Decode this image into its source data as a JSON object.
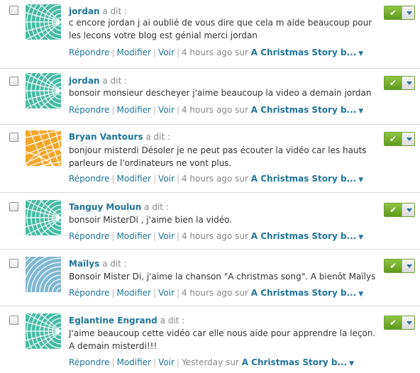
{
  "colors": {
    "link": "#21759b",
    "approve_green": "#7ab13b",
    "avatar_teal": "#45bba3",
    "avatar_orange": "#f4a62a",
    "avatar_blue": "#7eb7d3"
  },
  "labels": {
    "said": "a dit :",
    "reply": "Répondre",
    "edit": "Modifier",
    "view": "Voir",
    "on": "sur",
    "sep": "|"
  },
  "comments": [
    {
      "author": "jordan",
      "avatar_style": "teal-pattern",
      "text": "c encore jordan j ai oublié de vous dire que cela m aide beaucoup pour les lecons votre blog est génial merci jordan",
      "time": "4 hours ago",
      "post": "A Christmas Story b..."
    },
    {
      "author": "jordan",
      "avatar_style": "teal-pattern",
      "text": "bonsoir monsieur descheyer j'aime beaucoup la video a demain jordan",
      "time": "4 hours ago",
      "post": "A Christmas Story b..."
    },
    {
      "author": "Bryan Vantours",
      "avatar_style": "orange-pattern",
      "text": "bonjour misterdi Désoler je ne peut pas écouter la vidéo car les hauts parleurs de l'ordinateurs ne vont plus.",
      "time": "4 hours ago",
      "post": "A Christmas Story b..."
    },
    {
      "author": "Tanguy Moulun",
      "avatar_style": "teal-pattern",
      "text": "bonsoir MisterDi , j'aime bien la vidéo.",
      "time": "4 hours ago",
      "post": "A Christmas Story b..."
    },
    {
      "author": "Maïlys",
      "avatar_style": "blue-pattern",
      "text": "Bonsoir Mister Di, j'aime la chanson \"A christmas song\". A bienôt Maïlys",
      "time": "4 hours ago",
      "post": "A Christmas Story b..."
    },
    {
      "author": "Eglantine Engrand",
      "avatar_style": "teal-pattern",
      "text": "J'aime beaucoup cette vidéo car elle nous aide pour apprendre la leçon. A demain misterdi!!!",
      "time": "Yesterday",
      "post": "A Christmas Story b..."
    }
  ]
}
